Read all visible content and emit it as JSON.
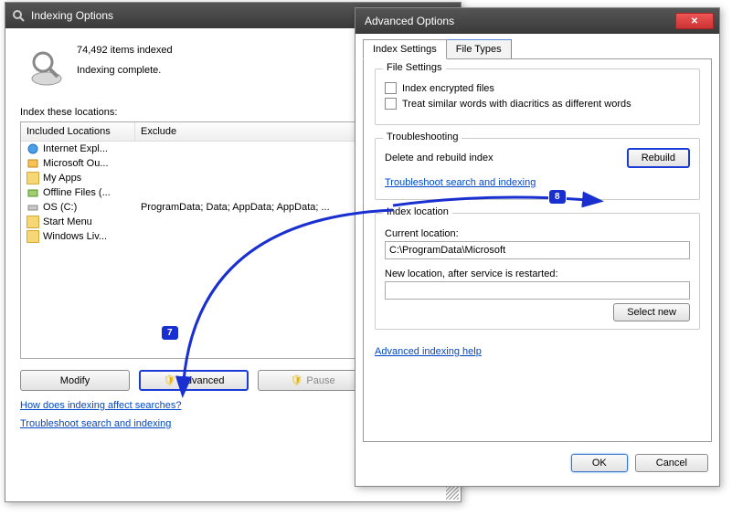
{
  "indexing_window": {
    "title": "Indexing Options",
    "status": {
      "count_text": "74,492 items indexed",
      "state_text": "Indexing complete."
    },
    "locations_label": "Index these locations:",
    "columns": {
      "included": "Included Locations",
      "exclude": "Exclude"
    },
    "rows": [
      {
        "label": "Internet Expl...",
        "icon": "ie",
        "exclude": ""
      },
      {
        "label": "Microsoft Ou...",
        "icon": "outlook",
        "exclude": ""
      },
      {
        "label": "My Apps",
        "icon": "folder",
        "exclude": ""
      },
      {
        "label": "Offline Files (...",
        "icon": "offline",
        "exclude": ""
      },
      {
        "label": "OS (C:)",
        "icon": "drive",
        "exclude": "ProgramData; Data; AppData; AppData; ..."
      },
      {
        "label": "Start Menu",
        "icon": "folder",
        "exclude": ""
      },
      {
        "label": "Windows Liv...",
        "icon": "folder",
        "exclude": ""
      }
    ],
    "buttons": {
      "modify": "Modify",
      "advanced": "Advanced",
      "pause": "Pause"
    },
    "links": {
      "how": "How does indexing affect searches?",
      "troubleshoot": "Troubleshoot search and indexing"
    }
  },
  "advanced_window": {
    "title": "Advanced Options",
    "tabs": {
      "index_settings": "Index Settings",
      "file_types": "File Types"
    },
    "file_settings": {
      "group": "File Settings",
      "opt1": "Index encrypted files",
      "opt2": "Treat similar words with diacritics as different words"
    },
    "troubleshooting": {
      "group": "Troubleshooting",
      "delete_label": "Delete and rebuild index",
      "rebuild_btn": "Rebuild",
      "link": "Troubleshoot search and indexing"
    },
    "index_location": {
      "group": "Index location",
      "current_label": "Current location:",
      "current_value": "C:\\ProgramData\\Microsoft",
      "new_label": "New location, after service is restarted:",
      "new_value": "",
      "select_btn": "Select new"
    },
    "help_link": "Advanced indexing help",
    "ok": "OK",
    "cancel": "Cancel"
  },
  "callouts": {
    "c7": "7",
    "c8": "8"
  }
}
